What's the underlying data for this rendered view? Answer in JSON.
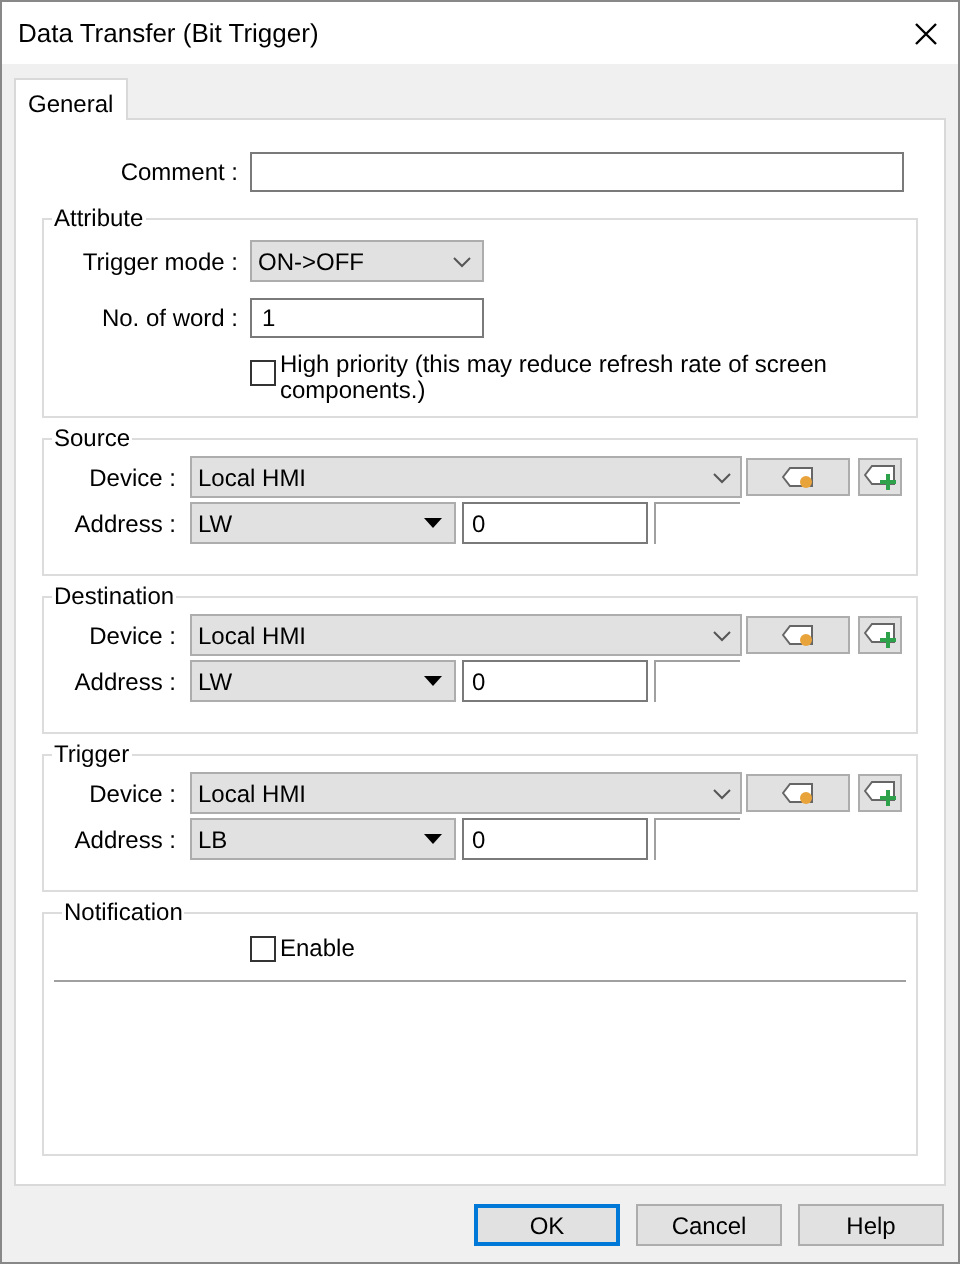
{
  "window": {
    "title": "Data Transfer (Bit Trigger)"
  },
  "tabs": [
    {
      "label": "General",
      "selected": true
    }
  ],
  "comment": {
    "label": "Comment :"
  },
  "attribute": {
    "title": "Attribute",
    "trigger_mode": {
      "label": "Trigger mode :",
      "value": "ON->OFF"
    },
    "word_count": {
      "label": "No. of word :",
      "value": "1"
    },
    "high_priority": {
      "label": "High priority (this may reduce refresh rate of screen components.)",
      "checked": false
    }
  },
  "sections": [
    {
      "title": "Source",
      "device_label": "Device :",
      "device": "Local HMI",
      "address_label": "Address :",
      "address_type": "LW",
      "address": "0"
    },
    {
      "title": "Destination",
      "device_label": "Device :",
      "device": "Local HMI",
      "address_label": "Address :",
      "address_type": "LW",
      "address": "0"
    },
    {
      "title": "Trigger",
      "device_label": "Device :",
      "device": "Local HMI",
      "address_label": "Address :",
      "address_type": "LB",
      "address": "0"
    }
  ],
  "notification": {
    "title": "Notification",
    "enable": {
      "label": "Enable",
      "checked": false
    }
  },
  "buttons": [
    {
      "label": "OK",
      "default": true
    },
    {
      "label": "Cancel",
      "default": false
    },
    {
      "label": "Help",
      "default": false
    }
  ]
}
